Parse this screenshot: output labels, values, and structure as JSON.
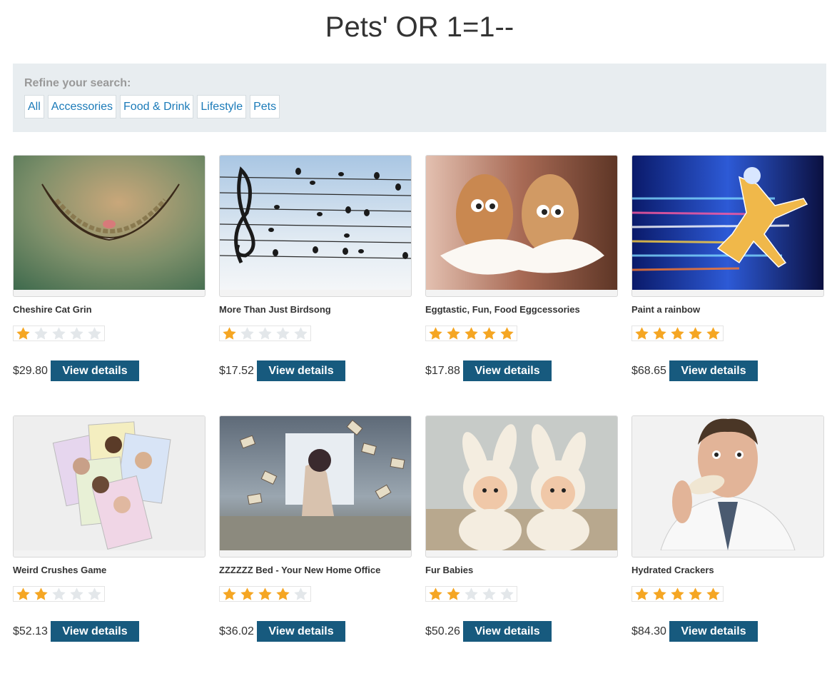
{
  "page": {
    "title": "Pets' OR 1=1--"
  },
  "filters": {
    "label": "Refine your search:",
    "items": [
      {
        "label": "All"
      },
      {
        "label": "Accessories"
      },
      {
        "label": "Food & Drink"
      },
      {
        "label": "Lifestyle"
      },
      {
        "label": "Pets"
      }
    ]
  },
  "colors": {
    "star_on": "#f5a623",
    "star_off": "#e3e7ea",
    "button": "#175a7e",
    "link": "#1a7ab8",
    "panel": "#e8edf0"
  },
  "products": [
    {
      "name": "Cheshire Cat Grin",
      "rating": 1,
      "price": "$29.80",
      "button": "View details",
      "image": "cheshire-cat-grin-image"
    },
    {
      "name": "More Than Just Birdsong",
      "rating": 1,
      "price": "$17.52",
      "button": "View details",
      "image": "music-staff-birds-image"
    },
    {
      "name": "Eggtastic, Fun, Food Eggcessories",
      "rating": 5,
      "price": "$17.88",
      "button": "View details",
      "image": "eggs-with-eyes-image"
    },
    {
      "name": "Paint a rainbow",
      "rating": 5,
      "price": "$68.65",
      "button": "View details",
      "image": "neon-runner-image"
    },
    {
      "name": "Weird Crushes Game",
      "rating": 2,
      "price": "$52.13",
      "button": "View details",
      "image": "crush-cards-image"
    },
    {
      "name": "ZZZZZZ Bed - Your New Home Office",
      "rating": 4,
      "price": "$36.02",
      "button": "View details",
      "image": "flying-books-bed-image"
    },
    {
      "name": "Fur Babies",
      "rating": 2,
      "price": "$50.26",
      "button": "View details",
      "image": "babies-bunny-hats-image"
    },
    {
      "name": "Hydrated Crackers",
      "rating": 5,
      "price": "$84.30",
      "button": "View details",
      "image": "man-eating-cracker-image"
    }
  ]
}
